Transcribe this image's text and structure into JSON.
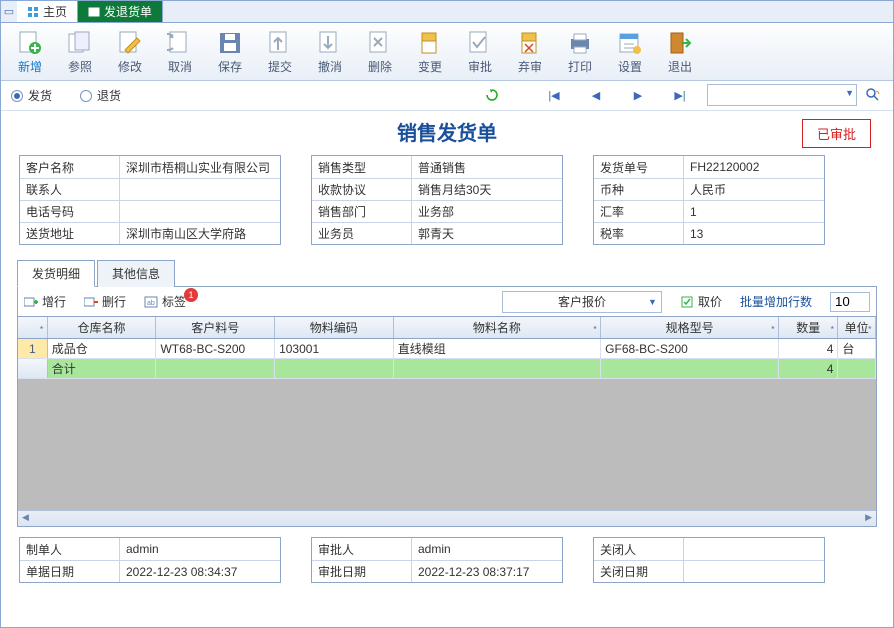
{
  "tabs": {
    "home": "主页",
    "active": "发退货单"
  },
  "toolbar": [
    {
      "k": "new",
      "label": "新增",
      "hl": true
    },
    {
      "k": "ref",
      "label": "参照"
    },
    {
      "k": "edit",
      "label": "修改"
    },
    {
      "k": "cancel",
      "label": "取消"
    },
    {
      "k": "save",
      "label": "保存"
    },
    {
      "k": "submit",
      "label": "提交"
    },
    {
      "k": "revoke",
      "label": "撤消"
    },
    {
      "k": "delete",
      "label": "删除"
    },
    {
      "k": "change",
      "label": "变更"
    },
    {
      "k": "approve",
      "label": "审批"
    },
    {
      "k": "reject",
      "label": "弃审"
    },
    {
      "k": "print",
      "label": "打印"
    },
    {
      "k": "settings",
      "label": "设置"
    },
    {
      "k": "exit",
      "label": "退出"
    }
  ],
  "radios": {
    "ship": "发货",
    "return": "退货"
  },
  "doc_title": "销售发货单",
  "stamp": "已审批",
  "col1": [
    {
      "label": "客户名称",
      "value": "深圳市梧桐山实业有限公司"
    },
    {
      "label": "联系人",
      "value": ""
    },
    {
      "label": "电话号码",
      "value": ""
    },
    {
      "label": "送货地址",
      "value": "深圳市南山区大学府路"
    }
  ],
  "col2": [
    {
      "label": "销售类型",
      "value": "普通销售"
    },
    {
      "label": "收款协议",
      "value": "销售月结30天"
    },
    {
      "label": "销售部门",
      "value": "业务部"
    },
    {
      "label": "业务员",
      "value": "郭青天"
    }
  ],
  "col3": [
    {
      "label": "发货单号",
      "value": "FH22120002"
    },
    {
      "label": "币种",
      "value": "人民币"
    },
    {
      "label": "汇率",
      "value": "1"
    },
    {
      "label": "税率",
      "value": "13"
    }
  ],
  "dtabs": {
    "detail": "发货明细",
    "other": "其他信息"
  },
  "dtb": {
    "addrow": "增行",
    "delrow": "删行",
    "label": "标签",
    "badge": "1",
    "price_combo": "客户报价",
    "getprice": "取价",
    "batch_label": "批量增加行数",
    "batch_value": "10"
  },
  "grid": {
    "headers": [
      "",
      "仓库名称",
      "客户料号",
      "物料编码",
      "物料名称",
      "规格型号",
      "数量",
      "单位"
    ],
    "widths": [
      30,
      110,
      120,
      120,
      210,
      180,
      60,
      38
    ],
    "pins": [
      true,
      false,
      false,
      false,
      true,
      true,
      true,
      true
    ],
    "rows": [
      {
        "n": "1",
        "cells": [
          "成品仓",
          "WT68-BC-S200",
          "103001",
          "直线模组",
          "GF68-BC-S200",
          "4",
          "台"
        ]
      }
    ],
    "total_label": "合计",
    "total_qty": "4"
  },
  "footer": {
    "c1": [
      {
        "label": "制单人",
        "value": "admin"
      },
      {
        "label": "单据日期",
        "value": "2022-12-23 08:34:37"
      }
    ],
    "c2": [
      {
        "label": "审批人",
        "value": "admin"
      },
      {
        "label": "审批日期",
        "value": "2022-12-23 08:37:17"
      }
    ],
    "c3": [
      {
        "label": "关闭人",
        "value": ""
      },
      {
        "label": "关闭日期",
        "value": ""
      }
    ]
  }
}
